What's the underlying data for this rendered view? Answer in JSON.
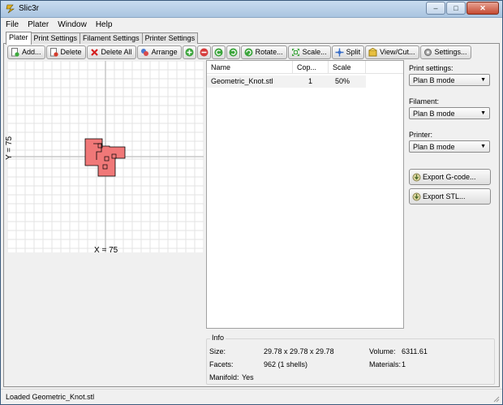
{
  "window": {
    "title": "Slic3r",
    "minimize": "–",
    "maximize": "□",
    "close": "✕"
  },
  "menu": [
    "File",
    "Plater",
    "Window",
    "Help"
  ],
  "tabs": [
    "Plater",
    "Print Settings",
    "Filament Settings",
    "Printer Settings"
  ],
  "toolbar": {
    "add": "Add...",
    "delete": "Delete",
    "delete_all": "Delete All",
    "arrange": "Arrange",
    "rotate": "Rotate...",
    "scale": "Scale...",
    "split": "Split",
    "view_cut": "View/Cut...",
    "settings": "Settings..."
  },
  "canvas": {
    "x_label": "X = 75",
    "y_label": "Y = 75"
  },
  "object_list": {
    "headers": [
      "Name",
      "Cop...",
      "Scale"
    ],
    "rows": [
      {
        "name": "Geometric_Knot.stl",
        "copies": "1",
        "scale": "50%"
      }
    ]
  },
  "print_settings": {
    "label": "Print settings:",
    "value": "Plan B mode"
  },
  "filament": {
    "label": "Filament:",
    "value": "Plan B mode"
  },
  "printer": {
    "label": "Printer:",
    "value": "Plan B mode"
  },
  "export_gcode": "Export G-code...",
  "export_stl": "Export STL...",
  "info": {
    "title": "Info",
    "size_label": "Size:",
    "size": "29.78 x 29.78 x 29.78",
    "volume_label": "Volume:",
    "volume": "6311.61",
    "facets_label": "Facets:",
    "facets": "962 (1 shells)",
    "materials_label": "Materials:",
    "materials": "1",
    "manifold_label": "Manifold:",
    "manifold": "Yes"
  },
  "status": "Loaded Geometric_Knot.stl",
  "colors": {
    "object_fill": "#f07878",
    "grid": "#e3e3e3",
    "axis": "#c8c8c8"
  }
}
